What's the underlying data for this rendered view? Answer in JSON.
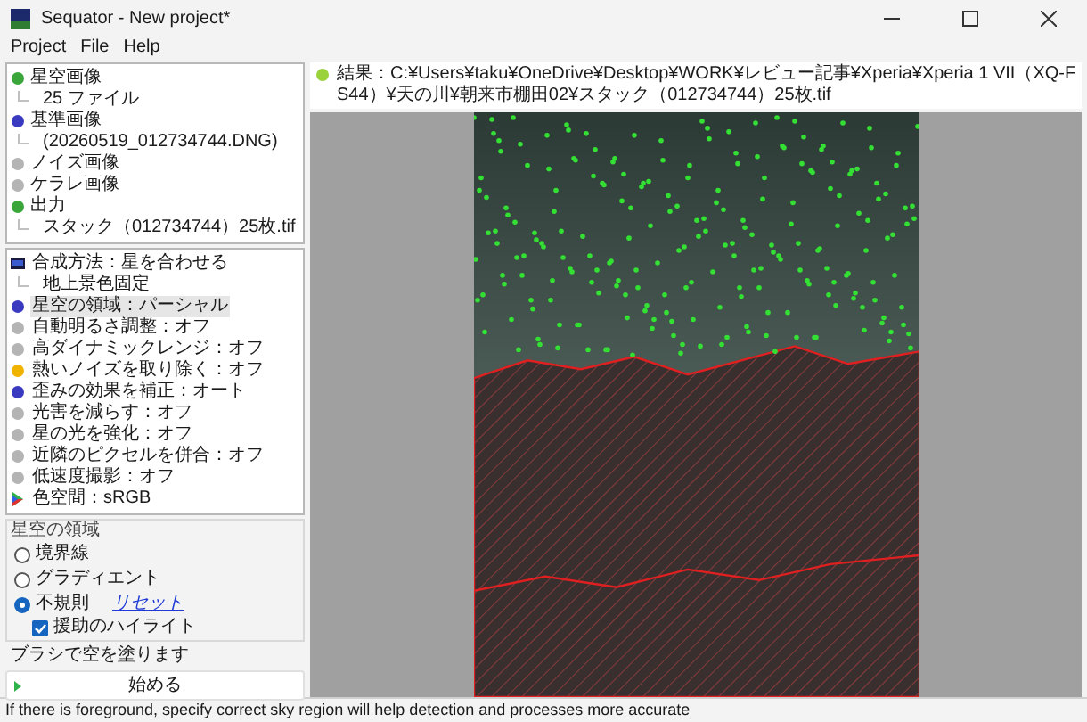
{
  "window": {
    "title": "Sequator - New project*"
  },
  "menu": [
    "Project",
    "File",
    "Help"
  ],
  "tree": [
    {
      "label": "星空画像",
      "color": "#3aa53a",
      "children": [
        {
          "label": "25 ファイル"
        }
      ]
    },
    {
      "label": "基準画像",
      "color": "#3a3ac0",
      "children": [
        {
          "label": "(20260519_012734744.DNG)"
        }
      ]
    },
    {
      "label": "ノイズ画像",
      "color": "#b4b4b4"
    },
    {
      "label": "ケラレ画像",
      "color": "#b4b4b4"
    },
    {
      "label": "出力",
      "color": "#3aa53a",
      "children": [
        {
          "label": "スタック（012734744）25枚.tif"
        }
      ]
    }
  ],
  "settings": [
    {
      "label": "合成方法：星を合わせる",
      "kind": "monitor",
      "selected": false,
      "children": [
        {
          "label": "地上景色固定"
        }
      ]
    },
    {
      "label": "星空の領域：パーシャル",
      "kind": "dot",
      "color": "#3a3ac0",
      "selected": true
    },
    {
      "label": "自動明るさ調整：オフ",
      "kind": "dot",
      "color": "#b4b4b4",
      "selected": false
    },
    {
      "label": "高ダイナミックレンジ：オフ",
      "kind": "dot",
      "color": "#b4b4b4",
      "selected": false
    },
    {
      "label": "熱いノイズを取り除く：オフ",
      "kind": "dot",
      "color": "#f0b400",
      "selected": false
    },
    {
      "label": "歪みの効果を補正：オート",
      "kind": "dot",
      "color": "#3a3ac0",
      "selected": false
    },
    {
      "label": "光害を減らす：オフ",
      "kind": "dot",
      "color": "#b4b4b4",
      "selected": false
    },
    {
      "label": "星の光を強化：オフ",
      "kind": "dot",
      "color": "#b4b4b4",
      "selected": false
    },
    {
      "label": "近隣のピクセルを併合：オフ",
      "kind": "dot",
      "color": "#b4b4b4",
      "selected": false
    },
    {
      "label": "低速度撮影：オフ",
      "kind": "dot",
      "color": "#b4b4b4",
      "selected": false
    },
    {
      "label": "色空間：sRGB",
      "kind": "triangle",
      "selected": false
    }
  ],
  "sky_region": {
    "title": "星空の領域",
    "options": [
      {
        "label": "境界線",
        "selected": false
      },
      {
        "label": "グラディエント",
        "selected": false
      },
      {
        "label": "不規則",
        "selected": true,
        "link": "リセット"
      }
    ],
    "highlight": {
      "label": "援助のハイライト",
      "checked": true
    },
    "hint": "ブラシで空を塗ります"
  },
  "start_button": {
    "label": "始める"
  },
  "result": {
    "path": "結果：C:¥Users¥taku¥OneDrive¥Desktop¥WORK¥レビュー記事¥Xperia¥Xperia 1 VII（XQ-FS44）¥天の川¥朝来市棚田02¥スタック（012734744）25枚.tif"
  },
  "status_bar": {
    "text": "If there is foreground, specify correct sky region will help detection and processes more accurate"
  }
}
